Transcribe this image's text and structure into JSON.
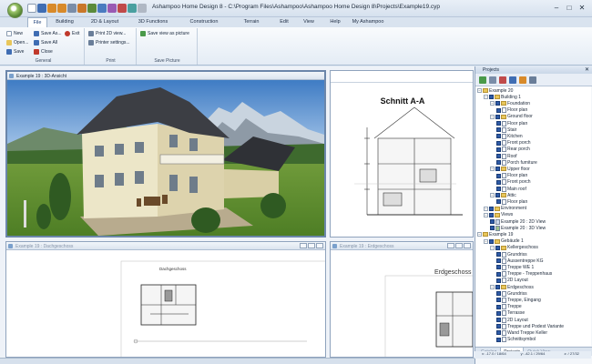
{
  "window": {
    "title": "Ashampoo Home Design 8 - C:\\Program Files\\Ashampoo\\Ashampoo Home Design 8\\Projects\\Example19.cyp",
    "controls": [
      "–",
      "□",
      "✕"
    ]
  },
  "ribbon": {
    "tabs": [
      "File",
      "Building",
      "2D & Layout",
      "3D Functions",
      "Construction",
      "Terrain",
      "Edit",
      "View",
      "Help",
      "My Ashampoo"
    ],
    "general": {
      "new": "New",
      "save_as": "Save As...",
      "exit": "Exit",
      "open": "Open...",
      "save_all": "Save All",
      "save": "Save",
      "close": "Close",
      "label": "General"
    },
    "print": {
      "print_2d": "Print 2D view...",
      "printer_settings": "Printer settings...",
      "label": "Print"
    },
    "save_picture": {
      "save_view": "Save view as picture",
      "label": "Save Picture"
    }
  },
  "panes": {
    "view3d": {
      "title": "Example 19 : 3D-Ansicht"
    },
    "section": {
      "title": "",
      "heading": "Schnitt A-A"
    },
    "dach": {
      "title": "Example 19 : Dachgeschoss",
      "label": "Dachgeschoss"
    },
    "erd": {
      "title": "Example 19 : Erdgeschoss",
      "label": "Erdgeschoss"
    }
  },
  "project_panel": {
    "title": "Projects",
    "tree": [
      {
        "label": "Example 20",
        "level": 0,
        "kind": "root"
      },
      {
        "label": "Building 1",
        "level": 1,
        "kind": "folder"
      },
      {
        "label": "Foundation",
        "level": 2,
        "kind": "folder"
      },
      {
        "label": "Floor plan",
        "level": 3,
        "kind": "doc"
      },
      {
        "label": "Ground floor",
        "level": 2,
        "kind": "folder"
      },
      {
        "label": "Floor plan",
        "level": 3,
        "kind": "doc"
      },
      {
        "label": "Stair",
        "level": 3,
        "kind": "doc"
      },
      {
        "label": "Kitchen",
        "level": 3,
        "kind": "doc"
      },
      {
        "label": "Front porch",
        "level": 3,
        "kind": "doc"
      },
      {
        "label": "Rear porch",
        "level": 3,
        "kind": "doc"
      },
      {
        "label": "Roof",
        "level": 3,
        "kind": "doc"
      },
      {
        "label": "Porch furniture",
        "level": 3,
        "kind": "doc"
      },
      {
        "label": "Upper floor",
        "level": 2,
        "kind": "folder"
      },
      {
        "label": "Floor plan",
        "level": 3,
        "kind": "doc"
      },
      {
        "label": "Front porch",
        "level": 3,
        "kind": "doc"
      },
      {
        "label": "Main roof",
        "level": 3,
        "kind": "doc"
      },
      {
        "label": "Attic",
        "level": 2,
        "kind": "folder"
      },
      {
        "label": "Floor plan",
        "level": 3,
        "kind": "doc"
      },
      {
        "label": "Environment",
        "level": 1,
        "kind": "folder"
      },
      {
        "label": "Views",
        "level": 1,
        "kind": "folder"
      },
      {
        "label": "Example 20 : 2D View",
        "level": 2,
        "kind": "view2d"
      },
      {
        "label": "Example 20 : 3D View",
        "level": 2,
        "kind": "view3d"
      },
      {
        "label": "Example 19",
        "level": 0,
        "kind": "root"
      },
      {
        "label": "Gebäude 1",
        "level": 1,
        "kind": "folder"
      },
      {
        "label": "Kellergeschoss",
        "level": 2,
        "kind": "folder"
      },
      {
        "label": "Grundriss",
        "level": 3,
        "kind": "doc"
      },
      {
        "label": "Aussentreppe KG",
        "level": 3,
        "kind": "doc"
      },
      {
        "label": "Treppe WE 1",
        "level": 3,
        "kind": "doc"
      },
      {
        "label": "Treppe - Treppenhaus",
        "level": 3,
        "kind": "doc"
      },
      {
        "label": "2D Layout",
        "level": 3,
        "kind": "doc"
      },
      {
        "label": "Erdgeschoss",
        "level": 2,
        "kind": "folder"
      },
      {
        "label": "Grundriss",
        "level": 3,
        "kind": "doc"
      },
      {
        "label": "Treppe, Eingang",
        "level": 3,
        "kind": "doc"
      },
      {
        "label": "Treppe",
        "level": 3,
        "kind": "doc"
      },
      {
        "label": "Terrasse",
        "level": 3,
        "kind": "doc"
      },
      {
        "label": "2D Layout",
        "level": 3,
        "kind": "doc"
      },
      {
        "label": "Treppe und Podest Variante",
        "level": 3,
        "kind": "doc"
      },
      {
        "label": "Wand Treppe Keller",
        "level": 3,
        "kind": "doc"
      },
      {
        "label": "Schnittsymbol",
        "level": 3,
        "kind": "doc"
      }
    ],
    "tabs": [
      "Catalog",
      "Projects",
      "Quick View"
    ],
    "active_tab": "Projects"
  },
  "status": {
    "coords": [
      "x: -17.0 / 18/64",
      "y: -42.1 / 29/64",
      "z: / 27/32"
    ]
  }
}
